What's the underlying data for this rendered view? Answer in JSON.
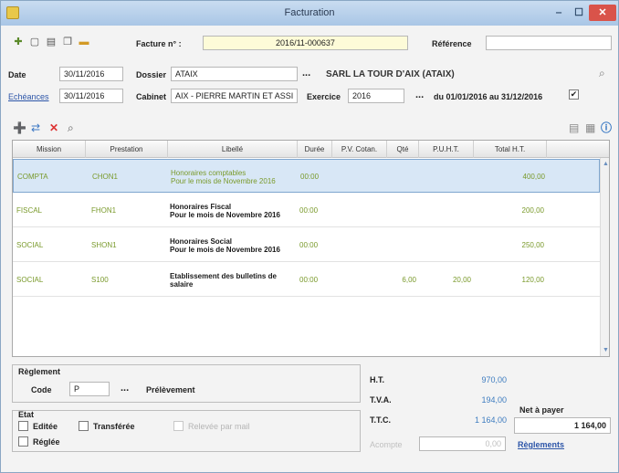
{
  "window": {
    "title": "Facturation",
    "min": "‒",
    "max": "☐",
    "close": "✕"
  },
  "toolbar": {
    "icons": [
      "new-document-icon",
      "save-icon",
      "print-icon",
      "copy-icon",
      "folder-icon"
    ],
    "facture_label": "Facture n° :",
    "facture_value": "2016/11-000637",
    "reference_label": "Référence",
    "reference_value": ""
  },
  "header": {
    "date_label": "Date",
    "date_value": "30/11/2016",
    "echeances_link": "Echéances",
    "echeances_value": "30/11/2016",
    "dossier_label": "Dossier",
    "dossier_value": "ATAIX",
    "dossier_ellipsis": "...",
    "client_name": "SARL LA TOUR D'AIX (ATAIX)",
    "cabinet_label": "Cabinet",
    "cabinet_value": "AIX - PIERRE MARTIN ET ASSI",
    "exercice_label": "Exercice",
    "exercice_value": "2016",
    "exercice_ellipsis": "...",
    "period_text": "du 01/01/2016 au 31/12/2016",
    "checkbox_checked": "✔"
  },
  "grid": {
    "columns": [
      "Mission",
      "Prestation",
      "Libellé",
      "Durée",
      "P.V. Cotan.",
      "Qté",
      "P.U.H.T.",
      "Total H.T."
    ],
    "rows": [
      {
        "mission": "COMPTA",
        "prestation": "CHON1",
        "libelle1": "Honoraires comptables",
        "libelle2": "Pour le mois de Novembre 2016",
        "duree": "00:00",
        "pv": "",
        "qte": "",
        "pu": "",
        "total": "400,00"
      },
      {
        "mission": "FISCAL",
        "prestation": "FHON1",
        "libelle1": "Honoraires Fiscal",
        "libelle2": "Pour le mois de Novembre 2016",
        "duree": "00:00",
        "pv": "",
        "qte": "",
        "pu": "",
        "total": "200,00"
      },
      {
        "mission": "SOCIAL",
        "prestation": "SHON1",
        "libelle1": "Honoraires Social",
        "libelle2": "Pour le mois de Novembre 2016",
        "duree": "00:00",
        "pv": "",
        "qte": "",
        "pu": "",
        "total": "250,00"
      },
      {
        "mission": "SOCIAL",
        "prestation": "S100",
        "libelle1": "Etablissement des bulletins de",
        "libelle2": "salaire",
        "duree": "00:00",
        "pv": "",
        "qte": "6,00",
        "pu": "20,00",
        "total": "120,00"
      }
    ]
  },
  "reglement": {
    "group_label": "Règlement",
    "code_label": "Code",
    "code_value": "P",
    "ellipsis": "...",
    "mode_text": "Prélèvement"
  },
  "etat": {
    "group_label": "Etat",
    "editee": "Editée",
    "transferee": "Transférée",
    "reglee": "Réglée",
    "disabled_option": "Relevée par mail"
  },
  "totals": {
    "ht_label": "H.T.",
    "ht_value": "970,00",
    "tva_label": "T.V.A.",
    "tva_value": "194,00",
    "ttc_label": "T.T.C.",
    "ttc_value": "1 164,00",
    "net_label": "Net à payer",
    "net_value": "1 164,00",
    "acompte_label": "Acompte",
    "acompte_value": "0,00",
    "reglements_link": "Règlements"
  }
}
